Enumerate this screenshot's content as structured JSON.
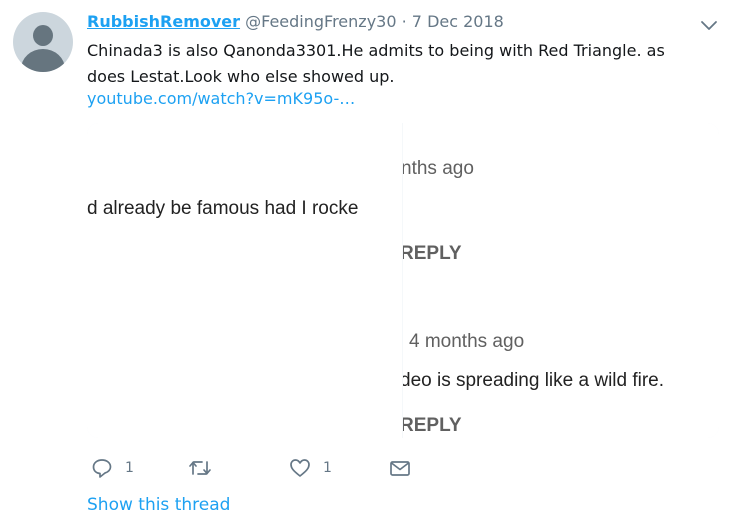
{
  "tweet": {
    "display_name": "RubbishRemover",
    "handle": "@FeedingFrenzy30",
    "separator": "·",
    "date": "7 Dec 2018",
    "text": "Chinada3 is also Qanonda3301.He admits to being with Red Triangle. as does Lestat.Look who else showed up.",
    "link": "youtube.com/watch?v=mK95o-…"
  },
  "card": {
    "left_panel": {
      "comment_text": "d already be famous had I rocke"
    },
    "right_panel": {
      "comment1_time": "nths ago",
      "comment1_reply": "REPLY",
      "comment2_time": "4 months ago",
      "comment2_text": "deo is spreading like a wild fire.",
      "comment2_reply": "REPLY"
    }
  },
  "actions": {
    "reply_count": "1",
    "like_count": "1"
  },
  "footer": {
    "show_thread": "Show this thread"
  },
  "icons": [
    "avatar-icon",
    "chevron-down-icon",
    "reply-icon",
    "retweet-icon",
    "like-icon",
    "message-icon"
  ],
  "colors": {
    "link": "#1da1f2",
    "muted": "#657786",
    "text": "#14171a"
  }
}
